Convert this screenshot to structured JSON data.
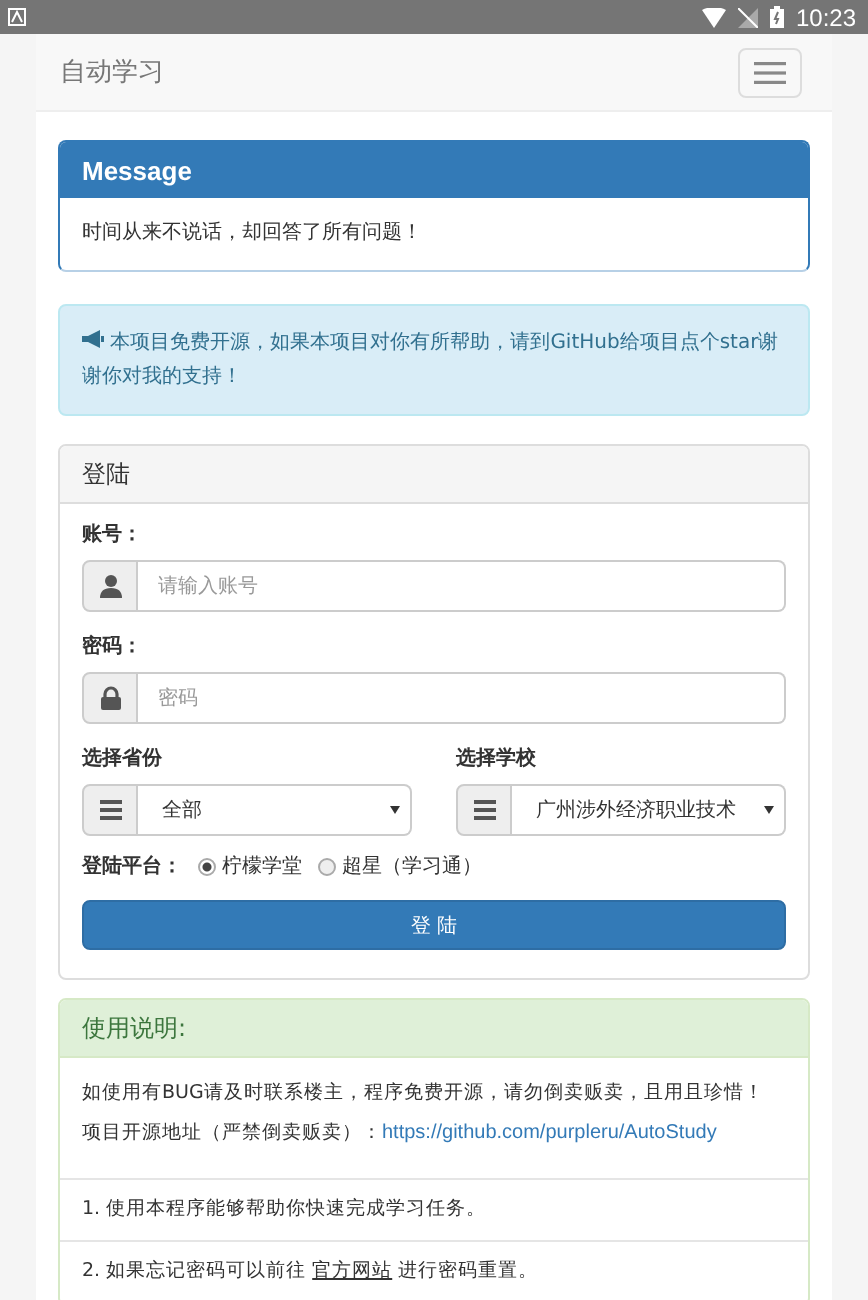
{
  "status_bar": {
    "time": "10:23"
  },
  "navbar": {
    "title": "自动学习"
  },
  "message": {
    "title": "Message",
    "body": "时间从来不说话，却回答了所有问题！"
  },
  "notice": {
    "text": "本项目免费开源，如果本项目对你有所帮助，请到GitHub给项目点个star谢谢你对我的支持！"
  },
  "login": {
    "title": "登陆",
    "fields": [
      {
        "kind": "user",
        "label": "账号：",
        "placeholder": "请输入账号"
      },
      {
        "kind": "lock",
        "label": "密码：",
        "placeholder": "密码"
      }
    ],
    "selects": [
      {
        "label": "选择省份",
        "value": "全部"
      },
      {
        "label": "选择学校",
        "value": "广州涉外经济职业技术"
      }
    ],
    "platform": {
      "label": "登陆平台：",
      "options": [
        {
          "label": "柠檬学堂",
          "selected": true
        },
        {
          "label": "超星（学习通）",
          "selected": false
        }
      ]
    },
    "button": "登 陆"
  },
  "usage": {
    "title": "使用说明:",
    "intro": [
      {
        "text": "如使用有BUG请及时联系楼主，程序免费开源，请勿倒卖贩卖，且用且珍惜！"
      },
      {
        "text": "项目开源地址（严禁倒卖贩卖）：",
        "link": "https://github.com/purpleru/AutoStudy"
      }
    ],
    "items": [
      {
        "text": "1. 使用本程序能够帮助你快速完成学习任务。"
      },
      {
        "text": "2. 如果忘记密码可以前往 ",
        "link": "官方网站",
        "after": " 进行密码重置。"
      }
    ]
  }
}
